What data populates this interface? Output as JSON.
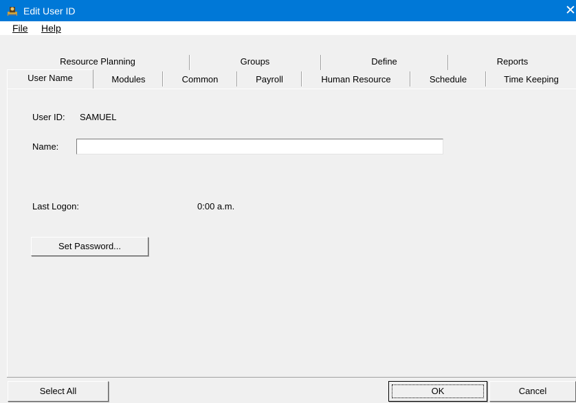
{
  "window": {
    "title": "Edit User ID",
    "close_glyph": "✕"
  },
  "menu": {
    "file": "File",
    "help": "Help"
  },
  "tabs_back": [
    "Resource Planning",
    "Groups",
    "Define",
    "Reports"
  ],
  "tabs_front": [
    "User Name",
    "Modules",
    "Common",
    "Payroll",
    "Human Resource",
    "Schedule",
    "Time Keeping"
  ],
  "active_tab": "User Name",
  "form": {
    "user_id_label": "User ID:",
    "user_id_value": "SAMUEL",
    "name_label": "Name:",
    "name_value": "",
    "last_logon_label": "Last Logon:",
    "last_logon_value": "0:00 a.m.",
    "set_password_button": "Set Password..."
  },
  "footer": {
    "select_all": "Select All",
    "ok": "OK",
    "cancel": "Cancel"
  },
  "colors": {
    "titlebar": "#0078d7",
    "background": "#f0f0f0"
  },
  "icons": {
    "app": "ship-wheel-icon",
    "close": "close-icon"
  }
}
